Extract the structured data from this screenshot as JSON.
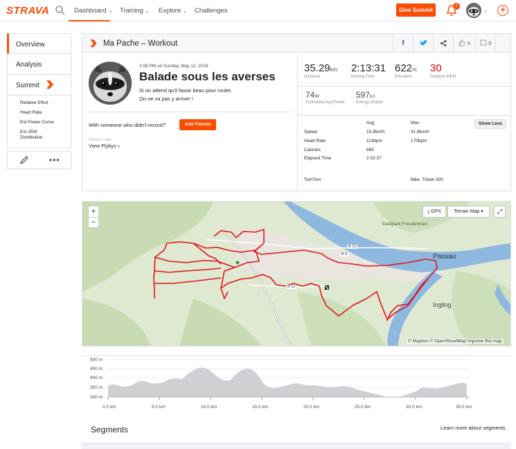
{
  "brand": {
    "logo": "STRAVA",
    "accent": "#fc4c02"
  },
  "nav": {
    "items": [
      {
        "label": "Dashboard",
        "chevron": true
      },
      {
        "label": "Training",
        "chevron": true
      },
      {
        "label": "Explore",
        "chevron": true
      },
      {
        "label": "Challenges",
        "chevron": false
      }
    ],
    "give_summit": "Give Summit",
    "notification_count": "2"
  },
  "sidebar": {
    "items": [
      "Overview",
      "Analysis",
      "Summit"
    ],
    "summit_sub": [
      "Relative Effort",
      "Heart Rate",
      "Est Power Curve",
      "Est 25W Distribution"
    ]
  },
  "activity": {
    "header_title": "Ma Pache – Workout",
    "kudos_count": "5",
    "comment_count": "0",
    "date": "2:08 PM on Sunday, May 12, 2019",
    "name": "Balade sous les averses",
    "description": [
      "Si on attend qu'il fasse beau pour rouler,",
      "On ne va pas y arriver !"
    ],
    "with_someone": "With someone who didn't record?",
    "add_friends": "Add Friends",
    "labs": "STRAVA LABS",
    "view_flybys": "View Flybys"
  },
  "stats": {
    "distance": {
      "value": "35.29",
      "unit": "km",
      "label": "Distance"
    },
    "moving_time": {
      "value": "2:13:31",
      "label": "Moving Time"
    },
    "elevation": {
      "value": "622",
      "unit": "m",
      "label": "Elevation"
    },
    "relative_effort": {
      "value": "30",
      "label": "Relative Effort"
    },
    "power": {
      "value": "74",
      "unit": "W",
      "label": "Estimated Avg Power"
    },
    "energy": {
      "value": "597",
      "unit": "kJ",
      "label": "Energy Output"
    }
  },
  "table": {
    "headers": [
      "",
      "Avg",
      "Max"
    ],
    "rows": [
      [
        "Speed",
        "15.9km/h",
        "41.8km/h"
      ],
      [
        "Heart Rate",
        "113bpm",
        "170bpm"
      ],
      [
        "Calories",
        "665",
        ""
      ],
      [
        "Elapsed Time",
        "2:32:37",
        ""
      ]
    ],
    "show_less": "Show Less",
    "device": "TomTom",
    "bike": "Bike: Triban 500"
  },
  "map": {
    "gpx": "GPX",
    "terrain": "Terrain Map",
    "attribution": "© Mapbox © OpenStreetMap Improve this map",
    "labels": [
      "Passau",
      "Ingling",
      "Stadtpark Freudenhain",
      "B 12",
      "B 8"
    ]
  },
  "elevation": {
    "y_ticks": [
      "500 m",
      "450 m",
      "400 m",
      "350 m",
      "300 m"
    ],
    "x_ticks": [
      "0.0 km",
      "5.0 km",
      "10.0 km",
      "15.0 km",
      "20.0 km",
      "25.0 km",
      "30.0 km",
      "35.0 km"
    ]
  },
  "segments": {
    "title": "Segments",
    "learn_more": "Learn more about segments"
  }
}
